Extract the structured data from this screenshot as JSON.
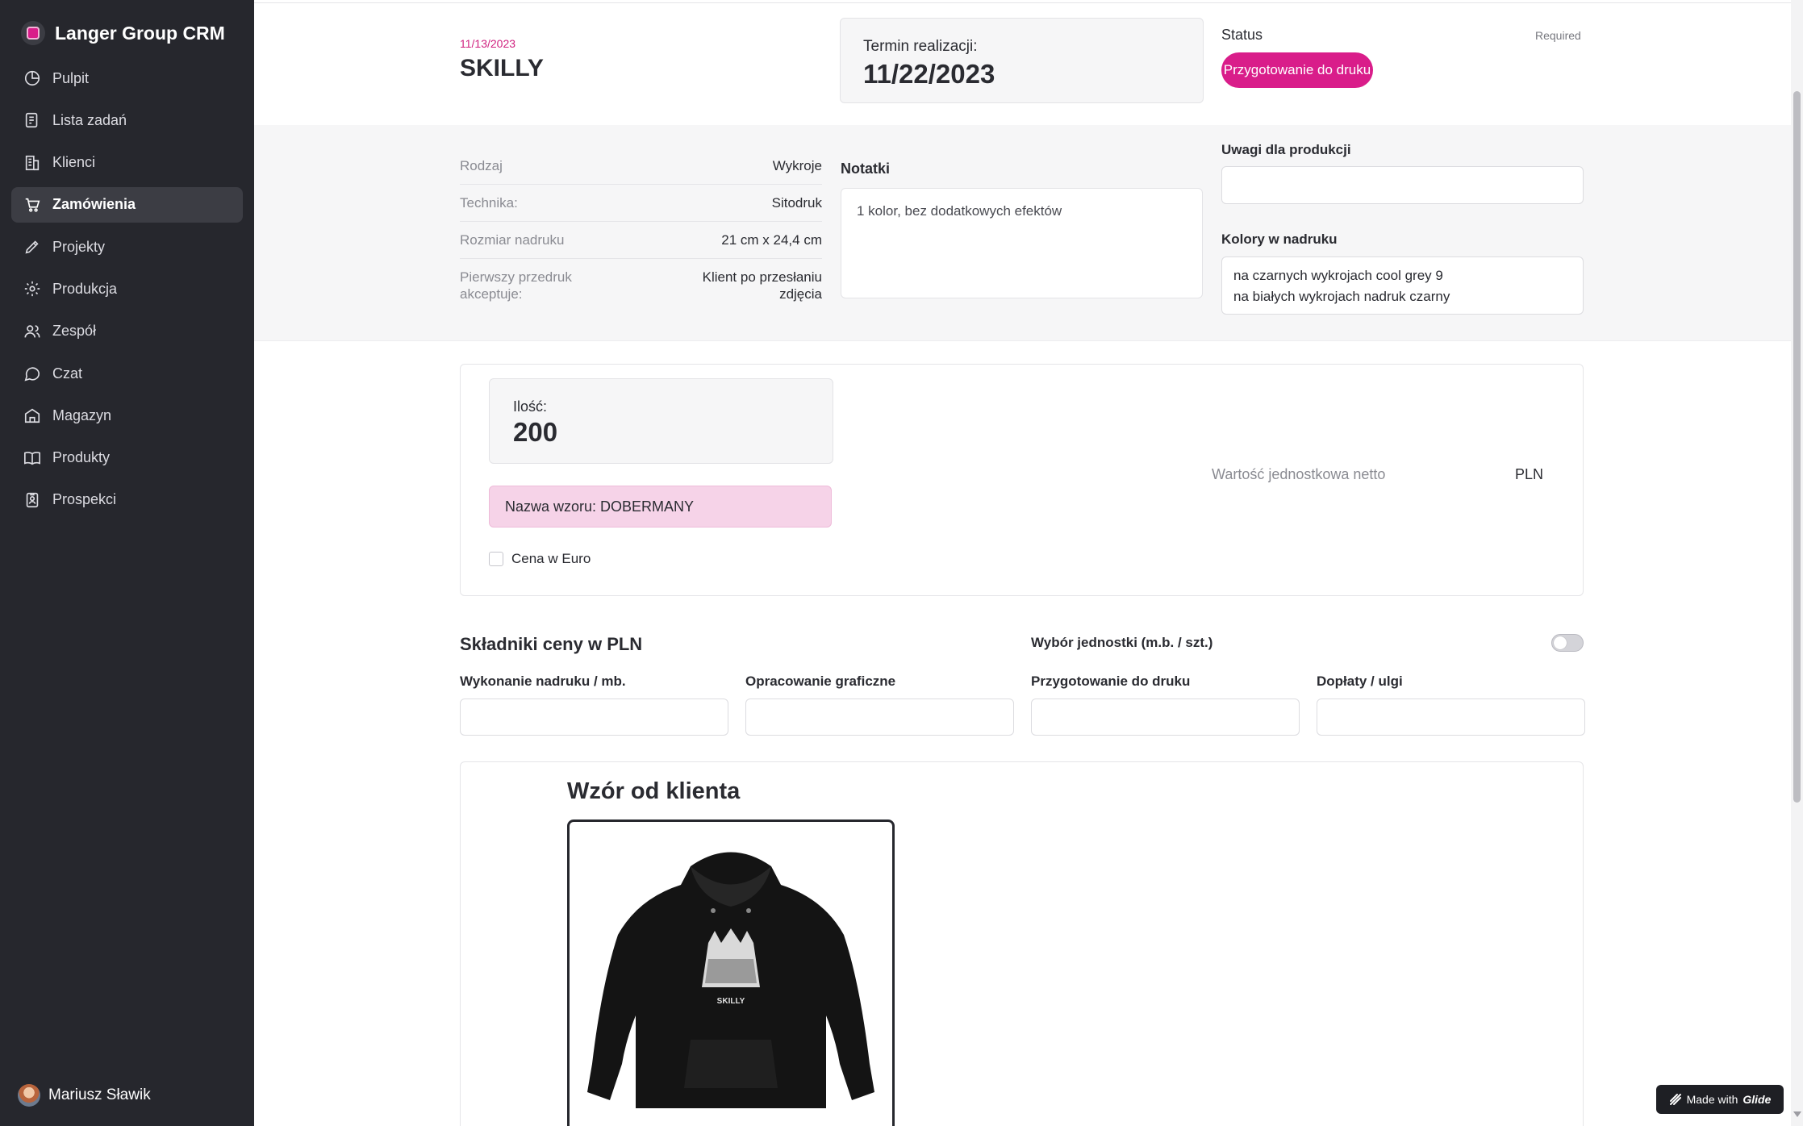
{
  "app": {
    "title": "Langer Group CRM"
  },
  "sidebar": {
    "items": [
      {
        "label": "Pulpit",
        "icon": "dashboard-icon",
        "active": false
      },
      {
        "label": "Lista zadań",
        "icon": "task-list-icon",
        "active": false
      },
      {
        "label": "Klienci",
        "icon": "building-icon",
        "active": false
      },
      {
        "label": "Zamówienia",
        "icon": "cart-icon",
        "active": true
      },
      {
        "label": "Projekty",
        "icon": "pen-icon",
        "active": false
      },
      {
        "label": "Produkcja",
        "icon": "gear-icon",
        "active": false
      },
      {
        "label": "Zespół",
        "icon": "team-icon",
        "active": false
      },
      {
        "label": "Czat",
        "icon": "chat-icon",
        "active": false
      },
      {
        "label": "Magazyn",
        "icon": "warehouse-icon",
        "active": false
      },
      {
        "label": "Produkty",
        "icon": "book-icon",
        "active": false
      },
      {
        "label": "Prospekci",
        "icon": "contact-card-icon",
        "active": false
      }
    ],
    "user": {
      "name": "Mariusz Sławik"
    }
  },
  "order": {
    "date": "11/13/2023",
    "title": "SKILLY",
    "deadline_label": "Termin realizacji:",
    "deadline_value": "11/22/2023",
    "status_label": "Status",
    "required_label": "Required",
    "status_value": "Przygotowanie do druku"
  },
  "details": [
    {
      "key": "Rodzaj",
      "value": "Wykroje"
    },
    {
      "key": "Technika:",
      "value": "Sitodruk"
    },
    {
      "key": "Rozmiar nadruku",
      "value": "21 cm x 24,4 cm"
    },
    {
      "key": "Pierwszy przedruk akceptuje:",
      "value": "Klient po przesłaniu zdjęcia"
    }
  ],
  "notes": {
    "label": "Notatki",
    "value": "1 kolor, bez dodatkowych efektów"
  },
  "production_notes": {
    "label": "Uwagi dla produkcji",
    "value": ""
  },
  "print_colors": {
    "label": "Kolory w nadruku",
    "line1": "na czarnych wykrojach cool grey 9",
    "line2": "na białych wykrojach nadruk czarny"
  },
  "quantity": {
    "label": "Ilość:",
    "value": "200",
    "pattern_name": "Nazwa wzoru: DOBERMANY",
    "euro_label": "Cena w Euro",
    "euro_checked": false,
    "unit_price_label": "Wartość jednostkowa netto",
    "unit_price_currency": "PLN"
  },
  "price_components": {
    "title": "Składniki ceny w PLN",
    "unit_choice_label": "Wybór jednostki (m.b. / szt.)",
    "unit_toggle_on": false,
    "fields": [
      {
        "label": "Wykonanie nadruku / mb.",
        "value": ""
      },
      {
        "label": "Opracowanie graficzne",
        "value": ""
      },
      {
        "label": "Przygotowanie do druku",
        "value": ""
      },
      {
        "label": "Dopłaty / ulgi",
        "value": ""
      }
    ]
  },
  "client_design": {
    "title": "Wzór od klienta",
    "image_caption": "SKILLY"
  },
  "footer": {
    "made_with": "Made with",
    "brand": "Glide"
  },
  "colors": {
    "sidebar_bg": "#26272d",
    "accent": "#d91d8a",
    "pattern_bg": "#f6d3e8",
    "panel_bg": "#f6f6f7"
  }
}
